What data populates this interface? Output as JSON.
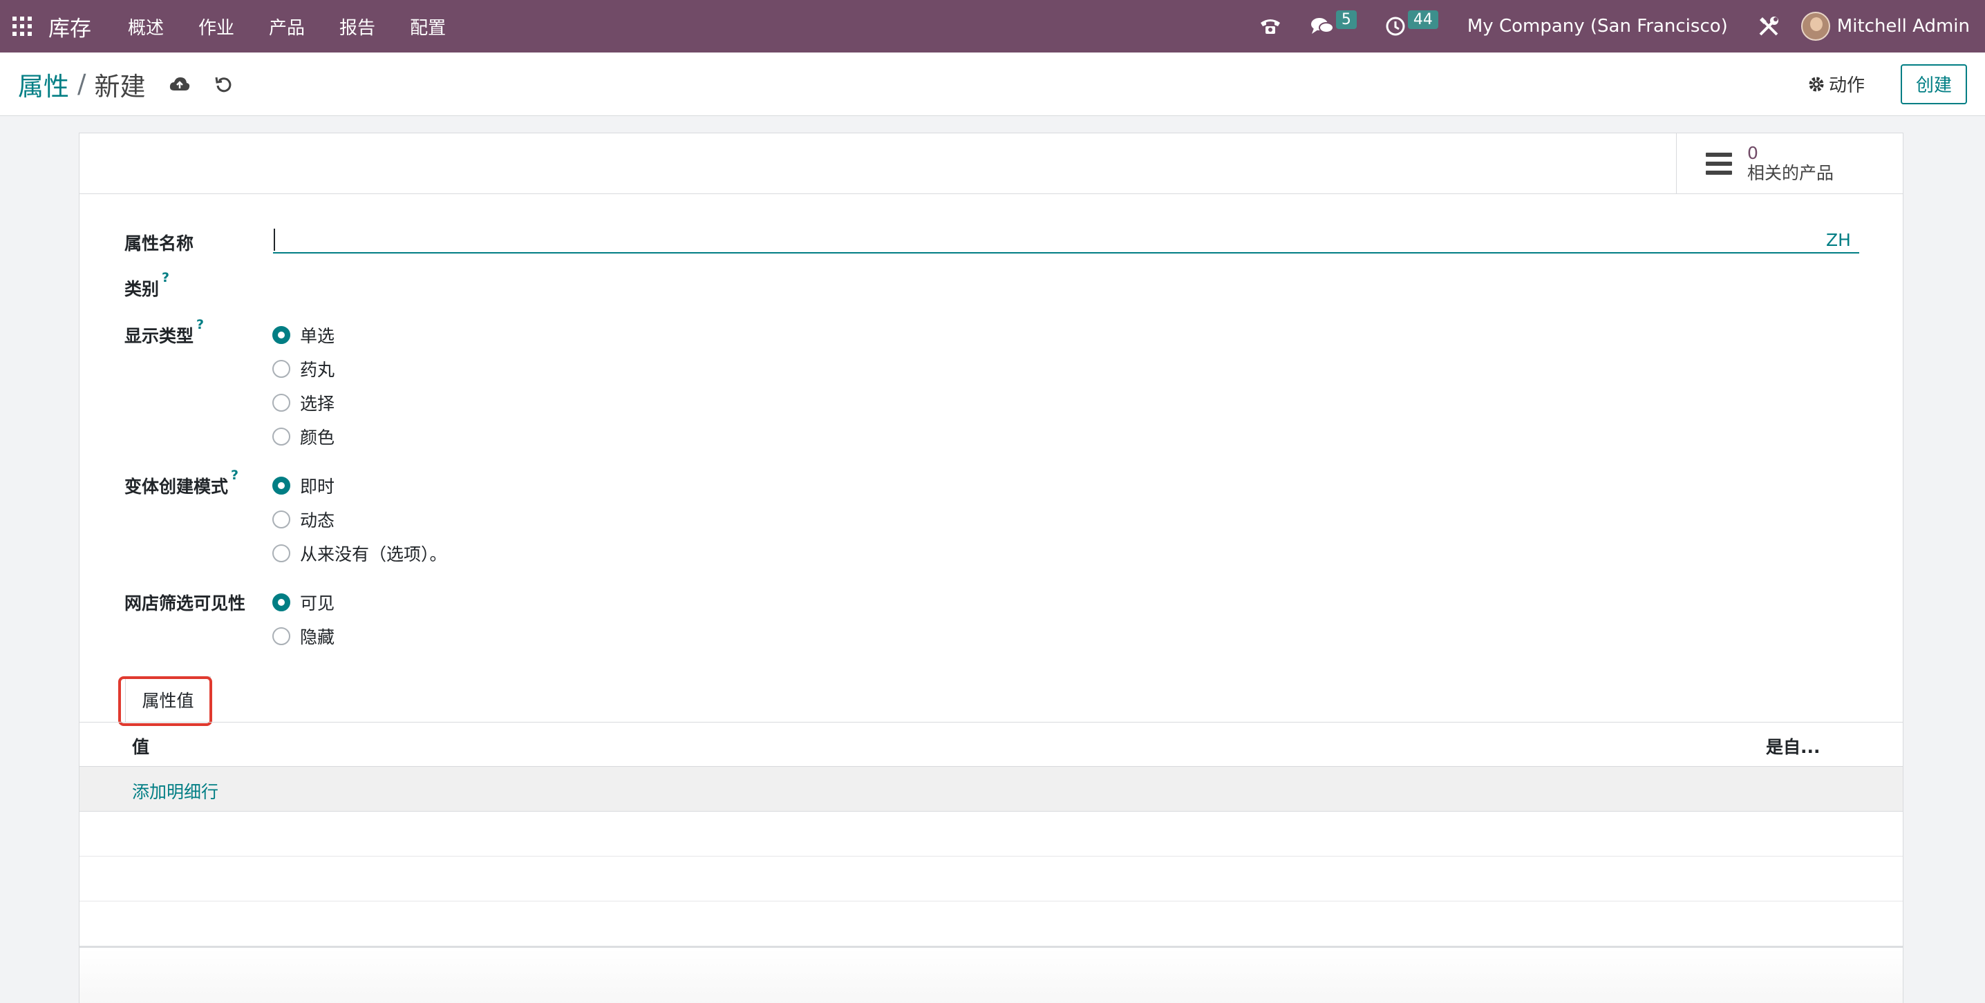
{
  "navbar": {
    "app_name": "库存",
    "menu": [
      "概述",
      "作业",
      "产品",
      "报告",
      "配置"
    ],
    "messages_count": "5",
    "activities_count": "44",
    "company": "My Company (San Francisco)",
    "user": "Mitchell Admin",
    "icons": [
      "apps-grid-icon",
      "phone-icon",
      "chat-icon",
      "clock-icon",
      "tools-icon",
      "avatar"
    ]
  },
  "breadcrumb": {
    "parent": "属性",
    "separator": "/",
    "current": "新建"
  },
  "control_panel": {
    "action_label": "动作",
    "create_label": "创建"
  },
  "stat_button": {
    "value": "0",
    "label": "相关的产品"
  },
  "form": {
    "name_label": "属性名称",
    "name_value": "",
    "lang": "ZH",
    "category_label": "类别",
    "help_mark": "?",
    "display_type_label": "显示类型",
    "display_type_options": [
      "单选",
      "药丸",
      "选择",
      "颜色"
    ],
    "display_type_selected": "单选",
    "variant_mode_label": "变体创建模式",
    "variant_mode_options": [
      "即时",
      "动态",
      "从来没有（选项）。"
    ],
    "variant_mode_selected": "即时",
    "visibility_label": "网店筛选可见性",
    "visibility_options": [
      "可见",
      "隐藏"
    ],
    "visibility_selected": "可见"
  },
  "tabs": {
    "values_tab": "属性值"
  },
  "values_list": {
    "col_value": "值",
    "col_custom": "是自...",
    "add_line": "添加明细行"
  },
  "colors": {
    "navbar": "#714b67",
    "accent": "#017e84",
    "highlight": "#e03a2f"
  }
}
